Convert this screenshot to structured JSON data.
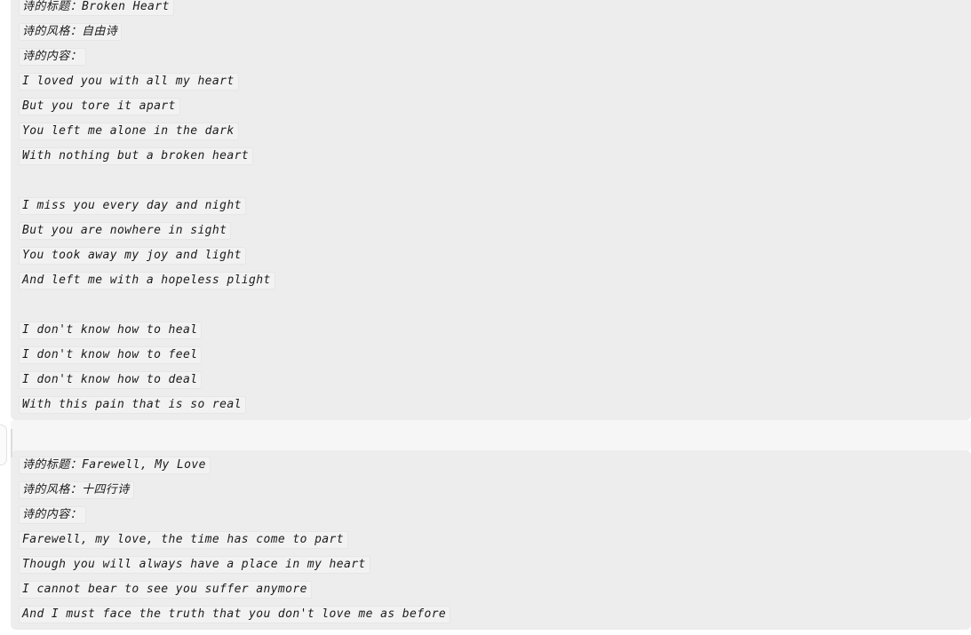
{
  "theme": {
    "page_background": "#ffffff",
    "message_background": "#ededed",
    "divider_background": "#f6f6f6",
    "line_chip_background": "#f2f2f2",
    "line_chip_border": "#e6e6e6",
    "text_color": "#1b1b1b"
  },
  "labels": {
    "title": "诗的标题：",
    "style": "诗的风格：",
    "content": "诗的内容："
  },
  "messages": [
    {
      "id": "poem-1",
      "title_line": "诗的标题：Broken Heart",
      "style_line": "诗的风格：自由诗",
      "content_line": "诗的内容：",
      "poem_title": "Broken Heart",
      "poem_style": "自由诗",
      "lines": [
        "I loved you with all my heart",
        "But you tore it apart",
        "You left me alone in the dark",
        "With nothing but a broken heart",
        "",
        "I miss you every day and night",
        "But you are nowhere in sight",
        "You took away my joy and light",
        "And left me with a hopeless plight",
        "",
        "I don't know how to heal",
        "I don't know how to feel",
        "I don't know how to deal",
        "With this pain that is so real"
      ]
    },
    {
      "id": "poem-2",
      "title_line": "诗的标题：Farewell, My Love",
      "style_line": "诗的风格：十四行诗",
      "content_line": "诗的内容：",
      "poem_title": "Farewell, My Love",
      "poem_style": "十四行诗",
      "lines": [
        "Farewell, my love, the time has come to part",
        "Though you will always have a place in my heart",
        "I cannot bear to see you suffer anymore",
        "And I must face the truth that you don't love me as before"
      ]
    }
  ]
}
